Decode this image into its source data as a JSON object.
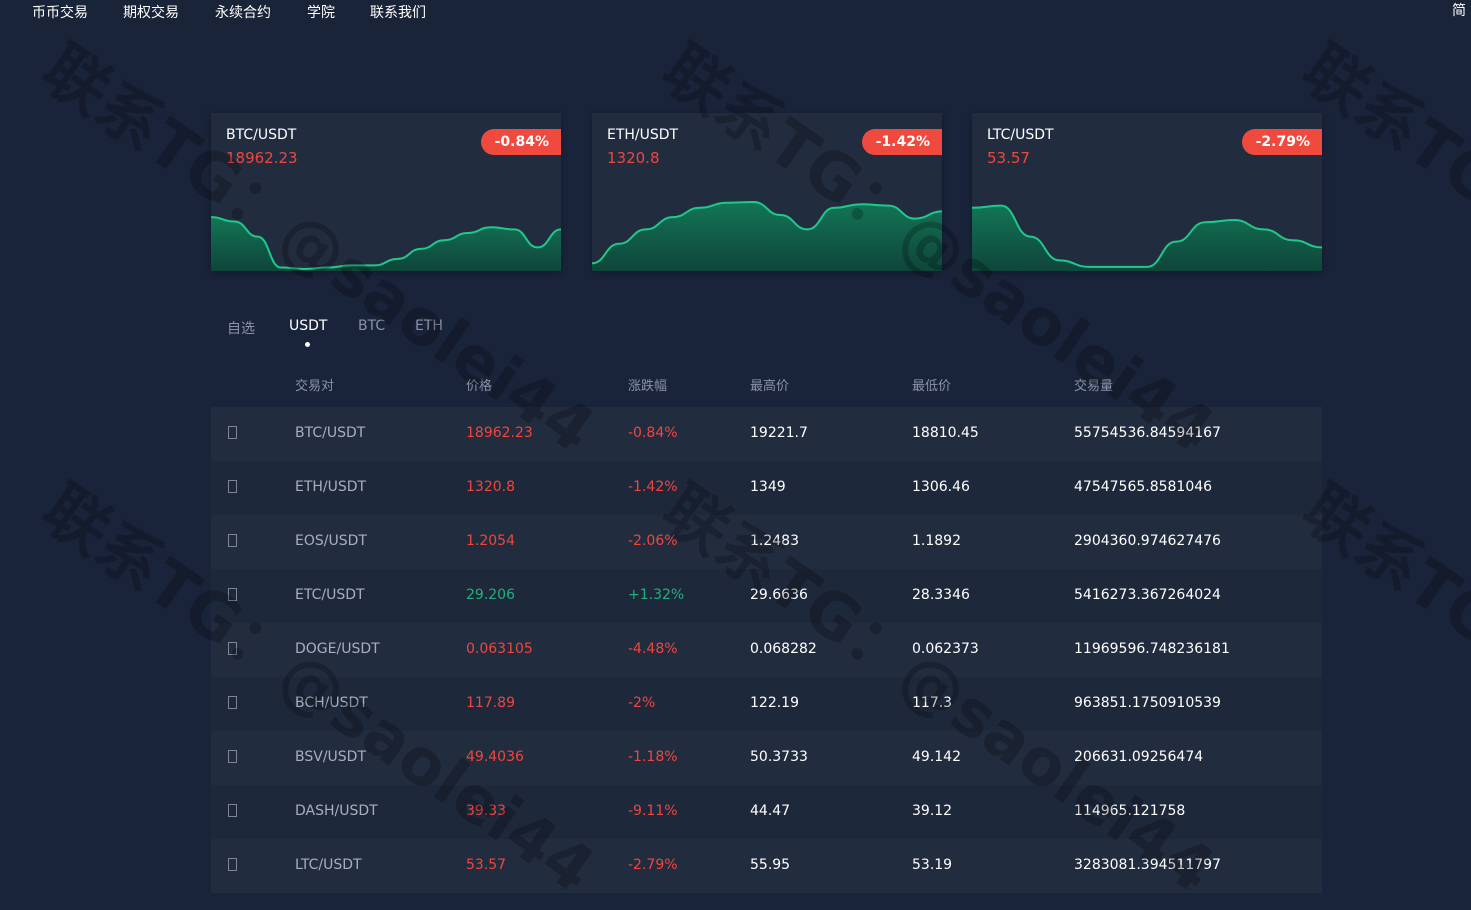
{
  "nav": {
    "items": [
      "币币交易",
      "期权交易",
      "永续合约",
      "学院",
      "联系我们"
    ],
    "lang": "简"
  },
  "cards": [
    {
      "pair": "BTC/USDT",
      "price": "18962.23",
      "change": "-0.84%",
      "trend": [
        0.72,
        0.66,
        0.45,
        0.02,
        0.0,
        0.02,
        0.05,
        0.05,
        0.14,
        0.28,
        0.4,
        0.5,
        0.58,
        0.55,
        0.3,
        0.55
      ]
    },
    {
      "pair": "ETH/USDT",
      "price": "1320.8",
      "change": "-1.42%",
      "trend": [
        0.08,
        0.35,
        0.55,
        0.72,
        0.85,
        0.92,
        0.93,
        0.75,
        0.55,
        0.85,
        0.9,
        0.88,
        0.7,
        0.8
      ]
    },
    {
      "pair": "LTC/USDT",
      "price": "53.57",
      "change": "-2.79%",
      "trend": [
        0.85,
        0.88,
        0.45,
        0.12,
        0.03,
        0.03,
        0.03,
        0.38,
        0.65,
        0.68,
        0.55,
        0.4,
        0.3
      ]
    }
  ],
  "tabs": [
    "自选",
    "USDT",
    "BTC",
    "ETH"
  ],
  "active_tab": "USDT",
  "columns": [
    "交易对",
    "价格",
    "涨跌幅",
    "最高价",
    "最低价",
    "交易量"
  ],
  "rows": [
    {
      "pair": "BTC/USDT",
      "price": "18962.23",
      "change": "-0.84%",
      "high": "19221.7",
      "low": "18810.45",
      "volume": "55754536.84594167",
      "dir": "down"
    },
    {
      "pair": "ETH/USDT",
      "price": "1320.8",
      "change": "-1.42%",
      "high": "1349",
      "low": "1306.46",
      "volume": "47547565.8581046",
      "dir": "down"
    },
    {
      "pair": "EOS/USDT",
      "price": "1.2054",
      "change": "-2.06%",
      "high": "1.2483",
      "low": "1.1892",
      "volume": "2904360.974627476",
      "dir": "down"
    },
    {
      "pair": "ETC/USDT",
      "price": "29.206",
      "change": "+1.32%",
      "high": "29.6636",
      "low": "28.3346",
      "volume": "5416273.367264024",
      "dir": "up"
    },
    {
      "pair": "DOGE/USDT",
      "price": "0.063105",
      "change": "-4.48%",
      "high": "0.068282",
      "low": "0.062373",
      "volume": "11969596.748236181",
      "dir": "down"
    },
    {
      "pair": "BCH/USDT",
      "price": "117.89",
      "change": "-2%",
      "high": "122.19",
      "low": "117.3",
      "volume": "963851.1750910539",
      "dir": "down"
    },
    {
      "pair": "BSV/USDT",
      "price": "49.4036",
      "change": "-1.18%",
      "high": "50.3733",
      "low": "49.142",
      "volume": "206631.09256474",
      "dir": "down"
    },
    {
      "pair": "DASH/USDT",
      "price": "39.33",
      "change": "-9.11%",
      "high": "44.47",
      "low": "39.12",
      "volume": "114965.121758",
      "dir": "down"
    },
    {
      "pair": "LTC/USDT",
      "price": "53.57",
      "change": "-2.79%",
      "high": "55.95",
      "low": "53.19",
      "volume": "3283081.394511797",
      "dir": "down"
    }
  ],
  "watermark": "联系TG：@saolei44",
  "colors": {
    "up": "#22b07b",
    "down": "#f2453d",
    "chart_fill": "#0f6b4e",
    "chart_line": "#1fc98a"
  }
}
